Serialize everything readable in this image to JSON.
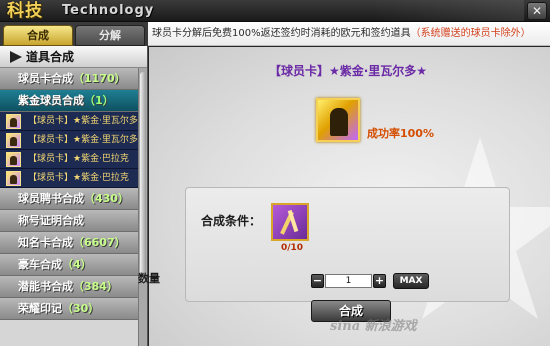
{
  "title": {
    "cn": "科技",
    "en": "Technology"
  },
  "tabs": [
    {
      "label": "合成",
      "active": true
    },
    {
      "label": "分解",
      "active": false
    }
  ],
  "notice": {
    "main": "球员卡分解后免费100%返还签约时消耗的欧元和签约道具",
    "note": "（系统赠送的球员卡除外）"
  },
  "sidebar": {
    "header": "道具合成",
    "items": [
      {
        "label": "球员卡合成",
        "count": "（1170）",
        "active": false
      },
      {
        "label": "紫金球员合成",
        "count": "（1）",
        "active": true
      },
      {
        "label": "【球员卡】★紫金·里瓦尔多",
        "sub": true
      },
      {
        "label": "【球员卡】★紫金·里瓦尔多",
        "sub": true
      },
      {
        "label": "【球员卡】★紫金·巴拉克",
        "sub": true
      },
      {
        "label": "【球员卡】★紫金·巴拉克",
        "sub": true
      },
      {
        "label": "球员聘书合成",
        "count": "（430）",
        "active": false
      },
      {
        "label": "称号证明合成",
        "count": "",
        "active": false
      },
      {
        "label": "知名卡合成",
        "count": "（6607）",
        "active": false
      },
      {
        "label": "豪车合成",
        "count": "（4）",
        "active": false
      },
      {
        "label": "潜能书合成",
        "count": "（384）",
        "active": false
      },
      {
        "label": "荣耀印记",
        "count": "（30）",
        "active": false
      }
    ]
  },
  "main": {
    "card_title": "【球员卡】★紫金·里瓦尔多★",
    "success_rate": "成功率100%",
    "condition_label": "合成条件：",
    "material_count": "0/10",
    "quantity_label": "数量",
    "quantity_value": "1",
    "max_label": "MAX",
    "compose_label": "合成"
  },
  "watermark": "sina 新浪游戏",
  "colors": {
    "accent_gold": "#f3d25a",
    "active_item": "#1f7f93",
    "success_rate": "#d44d00",
    "notice_note": "#d1401c"
  }
}
